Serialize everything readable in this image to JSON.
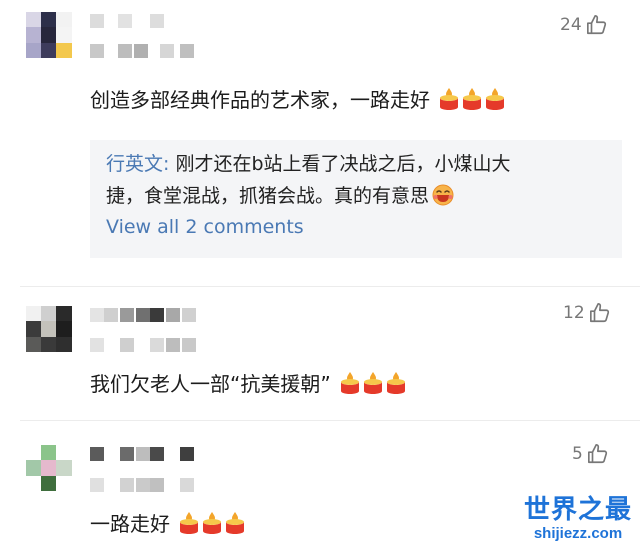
{
  "comments": [
    {
      "likes": "24",
      "text": "创造多部经典作品的艺术家，一路走好",
      "candles": 3,
      "reply": {
        "author": "行英文:",
        "line1": " 刚才还在b站上看了决战之后，小煤山大",
        "line2": "捷，食堂混战，抓猪会战。真的有意思",
        "view_all": "View all 2 comments"
      }
    },
    {
      "likes": "12",
      "text": "我们欠老人一部“抗美援朝”",
      "candles": 3
    },
    {
      "likes": "5",
      "text": "一路走好",
      "candles": 3
    }
  ],
  "icons": {
    "like": "thumbs-up-icon",
    "candle": "candle-emoji-icon",
    "laugh": "laughing-face-emoji-icon"
  },
  "colors": {
    "link": "#4a79b4",
    "reply_bg": "#f4f5f7",
    "candle_red": "#e53a2a",
    "watermark": "#1e73d8"
  },
  "watermark": {
    "title": "世界之最",
    "url": "shijiezz.com"
  }
}
